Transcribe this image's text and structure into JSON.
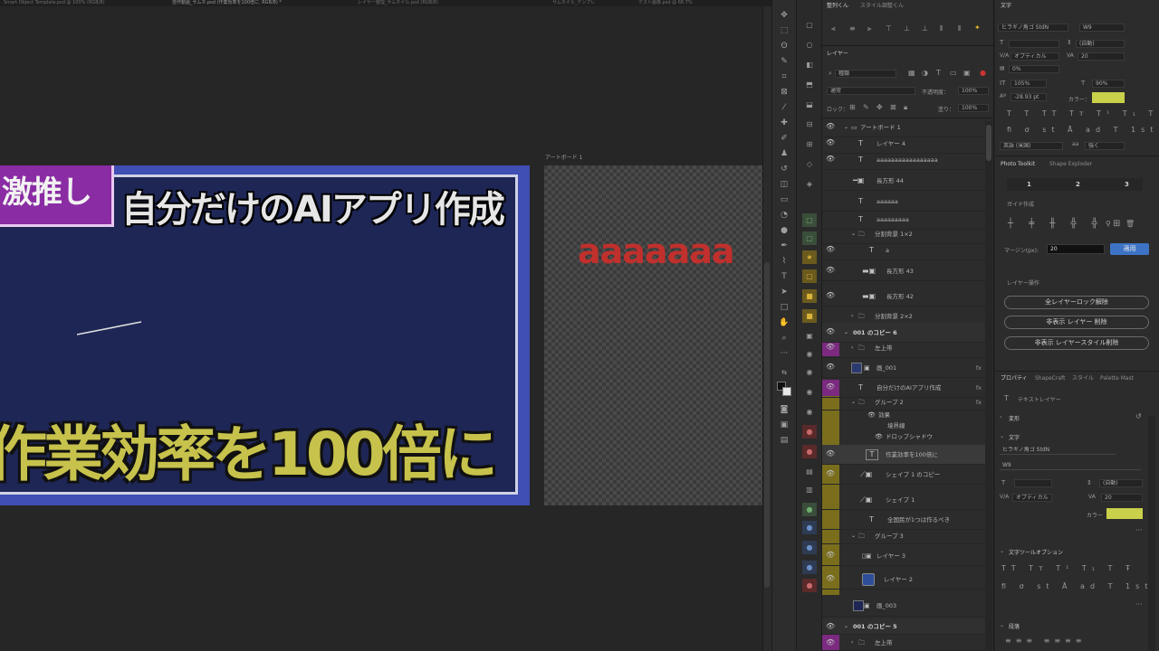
{
  "tabbar": {
    "tabs": [
      "Smart Object Template.psd @ 100% (RGB/8)",
      "自作動画_サムネ.psd (作業効率を100倍に, RGB/8) *",
      "レイヤー整理_サムネイル.psd (RGB/8)",
      "サムネイル_テンプレ",
      "テスト画像.psd @ 66.7%"
    ]
  },
  "canvas": {
    "badge_text": "激推し",
    "headline": "自分だけのAIアプリ作成",
    "bigline": "作業効率を100倍に",
    "artboard2_label": "アートボード 1",
    "artboard2_text": "aaaaaaa"
  },
  "colors": {
    "artboard_blue": "#3f4fb3",
    "artboard_bg": "#1e2656",
    "badge": "#8a2ca3",
    "big_text": "#c7c24c",
    "red_text": "#c0302c",
    "text_color_swatch": "#c9d04a"
  },
  "layers_panel": {
    "top_tabs": [
      "整列くん",
      "スタイル調整くん"
    ],
    "tab": "レイヤー",
    "filter_kind": "種類",
    "blend_mode": "通常",
    "opacity_label": "不透明度：",
    "opacity_value": "100%",
    "lock_label": "ロック：",
    "fill_label": "塗り：",
    "fill_value": "100%",
    "layers": [
      {
        "name": "アートボード 1",
        "type": "artboard"
      },
      {
        "name": "レイヤー 4",
        "type": "T"
      },
      {
        "name": "aaaaaaaaaaaaaaaaa",
        "type": "T"
      },
      {
        "name": "長方形 44",
        "type": "rect"
      },
      {
        "name": "aaaaaa",
        "type": "T"
      },
      {
        "name": "aaaaaaaaa",
        "type": "T"
      },
      {
        "name": "分割背景 1×2",
        "type": "folder"
      },
      {
        "name": "a",
        "type": "T"
      },
      {
        "name": "長方形 43",
        "type": "rect"
      },
      {
        "name": "長方形 42",
        "type": "rect"
      },
      {
        "name": "分割背景 2×2",
        "type": "folder"
      },
      {
        "name": "001 のコピー 6",
        "type": "artboard"
      },
      {
        "name": "左上帯",
        "type": "folder"
      },
      {
        "name": "画_001",
        "type": "image",
        "fx": "fx"
      },
      {
        "name": "自分だけのAIアプリ作成",
        "type": "T",
        "fx": "fx"
      },
      {
        "name": "グループ 2",
        "type": "folder",
        "fx": "fx"
      },
      {
        "name": "効果",
        "type": "effect"
      },
      {
        "name": "境界線",
        "type": "effect"
      },
      {
        "name": "ドロップシャドウ",
        "type": "effect"
      },
      {
        "name": "作業効率を100倍に",
        "type": "T"
      },
      {
        "name": "シェイプ 1 のコピー",
        "type": "shape"
      },
      {
        "name": "シェイプ 1",
        "type": "shape"
      },
      {
        "name": "全国民が1つは作るべき",
        "type": "T"
      },
      {
        "name": "グループ 3",
        "type": "folder"
      },
      {
        "name": "レイヤー 3",
        "type": "image"
      },
      {
        "name": "レイヤー 2",
        "type": "image"
      },
      {
        "name": "画_003",
        "type": "image"
      },
      {
        "name": "001 のコピー 5",
        "type": "artboard"
      },
      {
        "name": "左上帯",
        "type": "folder"
      }
    ]
  },
  "character_panel": {
    "tab": "文字",
    "font_family": "ヒラギノ角ゴ StdN",
    "font_weight": "W9",
    "leading": "(自動)",
    "tracking_mode": "オプティカル",
    "tracking_value": "20",
    "tsume": "0%",
    "vscale": "105%",
    "hscale": "90%",
    "baseline": "-28.93 pt",
    "color_label": "カラー：",
    "language": "英語 (米国)",
    "antialias": "強く"
  },
  "photo_toolkit": {
    "tabs": [
      "Photo Toolkit",
      "Shape Exploder"
    ],
    "columns": [
      "1",
      "2",
      "3"
    ],
    "guide_label": "ガイド作成",
    "margin_label": "マージン(px):",
    "margin_value": "20",
    "apply_label": "適用",
    "layer_ops_label": "レイヤー操作",
    "btn_unlock": "全レイヤーロック解除",
    "btn_delete_hidden": "非表示 レイヤー 削除",
    "btn_delete_hidden_style": "非表示 レイヤースタイル削除"
  },
  "properties_panel": {
    "tabs": [
      "プロパティ",
      "ShapeCraft",
      "スタイル",
      "Palette Mast"
    ],
    "kind": "テキストレイヤー",
    "transform_label": "変形",
    "char_label": "文字",
    "font_family": "ヒラギノ角ゴ StdN",
    "font_weight": "W9",
    "leading": "(自動)",
    "tracking_mode": "オプティカル",
    "tracking_value": "20",
    "color_label": "カラー",
    "text_tool_options": "文字ツールオプション",
    "paragraph_label": "段落"
  }
}
